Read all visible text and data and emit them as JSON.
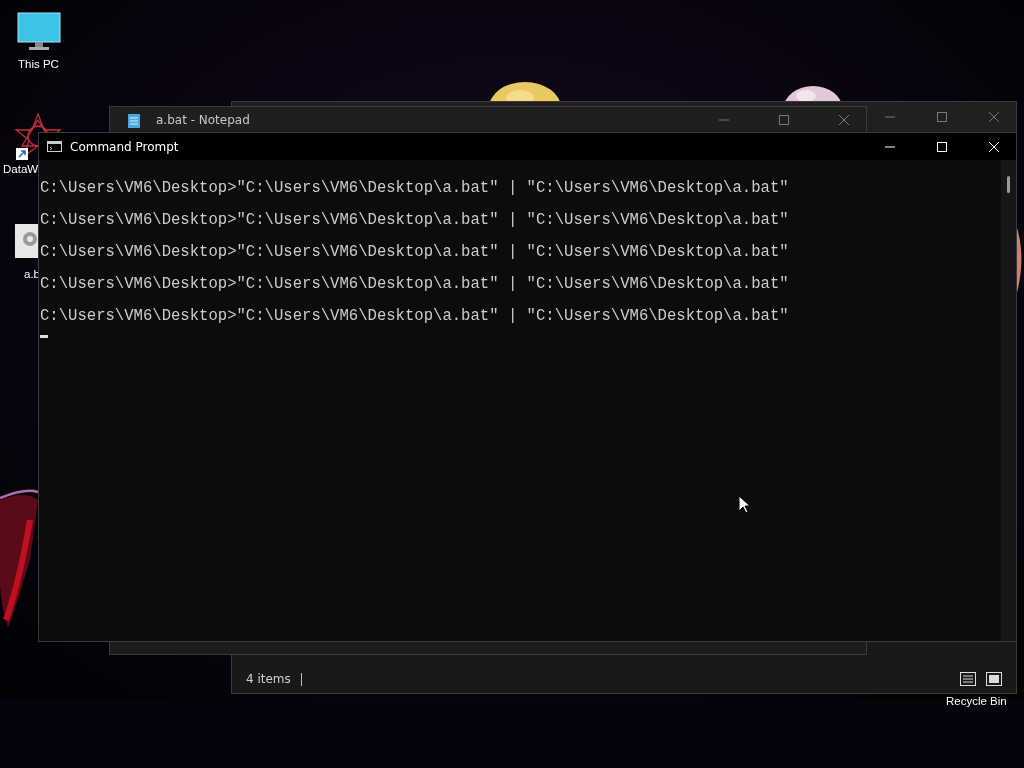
{
  "desktop_icons": [
    {
      "kind": "monitor",
      "label": "This PC"
    },
    {
      "kind": "star",
      "label": "DataW"
    },
    {
      "kind": "file",
      "label": "a.b"
    },
    {
      "kind": "bin",
      "label": "Recycle Bin"
    }
  ],
  "explorer": {
    "status_text": "4 items"
  },
  "notepad": {
    "title": "a.bat - Notepad"
  },
  "cmd": {
    "title": "Command Prompt",
    "lines": [
      "C:\\Users\\VM6\\Desktop>\"C:\\Users\\VM6\\Desktop\\a.bat\" | \"C:\\Users\\VM6\\Desktop\\a.bat\"",
      "C:\\Users\\VM6\\Desktop>\"C:\\Users\\VM6\\Desktop\\a.bat\" | \"C:\\Users\\VM6\\Desktop\\a.bat\"",
      "C:\\Users\\VM6\\Desktop>\"C:\\Users\\VM6\\Desktop\\a.bat\" | \"C:\\Users\\VM6\\Desktop\\a.bat\"",
      "C:\\Users\\VM6\\Desktop>\"C:\\Users\\VM6\\Desktop\\a.bat\" | \"C:\\Users\\VM6\\Desktop\\a.bat\"",
      "C:\\Users\\VM6\\Desktop>\"C:\\Users\\VM6\\Desktop\\a.bat\" | \"C:\\Users\\VM6\\Desktop\\a.bat\""
    ]
  }
}
